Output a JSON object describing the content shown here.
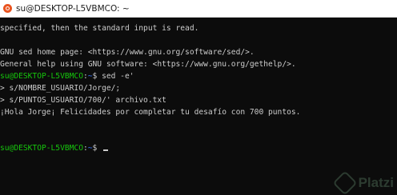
{
  "window": {
    "title": "su@DESKTOP-L5VBMCO: ~",
    "icon": "ubuntu-icon"
  },
  "terminal": {
    "lines": [
      {
        "kind": "text",
        "text": "specified, then the standard input is read."
      },
      {
        "kind": "text",
        "text": ""
      },
      {
        "kind": "text",
        "text": "GNU sed home page: <https://www.gnu.org/software/sed/>."
      },
      {
        "kind": "text",
        "text": "General help using GNU software: <https://www.gnu.org/gethelp/>."
      },
      {
        "kind": "prompt",
        "user": "su@DESKTOP-L5VBMCO",
        "sep": ":",
        "path": "~",
        "cmd": "$ sed -e'"
      },
      {
        "kind": "text",
        "text": "> s/NOMBRE_USUARIO/Jorge/;"
      },
      {
        "kind": "text",
        "text": "> s/PUNTOS_USUARIO/700/' archivo.txt"
      },
      {
        "kind": "text",
        "text": "¡Hola Jorge¡ Felicidades por completar tu desafío con 700 puntos."
      },
      {
        "kind": "text",
        "text": ""
      },
      {
        "kind": "text",
        "text": ""
      },
      {
        "kind": "prompt",
        "user": "su@DESKTOP-L5VBMCO",
        "sep": ":",
        "path": "~",
        "cmd": "$ ",
        "cursor": true
      }
    ]
  },
  "watermark": {
    "text": "Platzi",
    "color": "#9fe3b0"
  },
  "colors": {
    "background": "#0c0c0c",
    "foreground": "#cccccc",
    "prompt_user": "#16c60c",
    "prompt_path": "#3b78ff"
  }
}
